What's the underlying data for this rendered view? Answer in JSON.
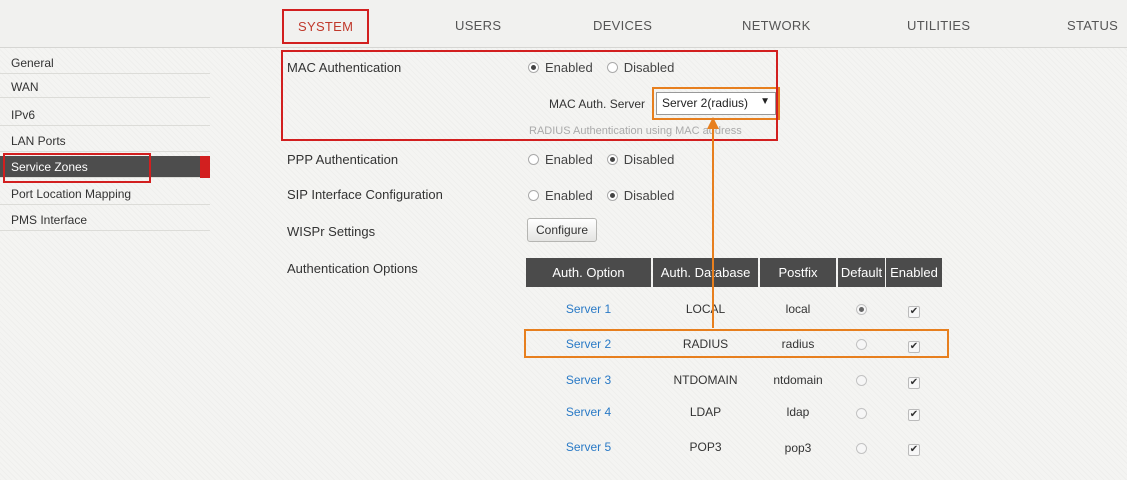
{
  "nav": {
    "tabs": [
      "SYSTEM",
      "USERS",
      "DEVICES",
      "NETWORK",
      "UTILITIES",
      "STATUS"
    ],
    "active": "SYSTEM"
  },
  "sidebar": {
    "items": [
      "General",
      "WAN",
      "IPv6",
      "LAN Ports",
      "Service Zones",
      "Port Location Mapping",
      "PMS Interface"
    ],
    "active": "Service Zones"
  },
  "form": {
    "mac_auth": {
      "label": "MAC Authentication",
      "options": [
        "Enabled",
        "Disabled"
      ],
      "selected": "Enabled",
      "server_label": "MAC Auth. Server",
      "server_value": "Server 2(radius)",
      "hint": "RADIUS Authentication using MAC address"
    },
    "ppp_auth": {
      "label": "PPP Authentication",
      "options": [
        "Enabled",
        "Disabled"
      ],
      "selected": "Disabled"
    },
    "sip": {
      "label": "SIP Interface Configuration",
      "options": [
        "Enabled",
        "Disabled"
      ],
      "selected": "Disabled"
    },
    "wispr": {
      "label": "WISPr Settings",
      "button": "Configure"
    },
    "auth_options": {
      "label": "Authentication Options"
    }
  },
  "auth_table": {
    "headers": [
      "Auth. Option",
      "Auth. Database",
      "Postfix",
      "Default",
      "Enabled"
    ],
    "rows": [
      {
        "option": "Server 1",
        "database": "LOCAL",
        "postfix": "local",
        "default": true,
        "enabled": true
      },
      {
        "option": "Server 2",
        "database": "RADIUS",
        "postfix": "radius",
        "default": false,
        "enabled": true
      },
      {
        "option": "Server 3",
        "database": "NTDOMAIN",
        "postfix": "ntdomain",
        "default": false,
        "enabled": true
      },
      {
        "option": "Server 4",
        "database": "LDAP",
        "postfix": "ldap",
        "default": false,
        "enabled": true
      },
      {
        "option": "Server 5",
        "database": "POP3",
        "postfix": "pop3",
        "default": false,
        "enabled": true
      }
    ]
  },
  "colors": {
    "highlight_red": "#d21f1f",
    "highlight_orange": "#e77f1e",
    "link_blue": "#2a7ac6",
    "header_dark": "#4b4b4b",
    "sidebar_active": "#4d4d4d"
  }
}
